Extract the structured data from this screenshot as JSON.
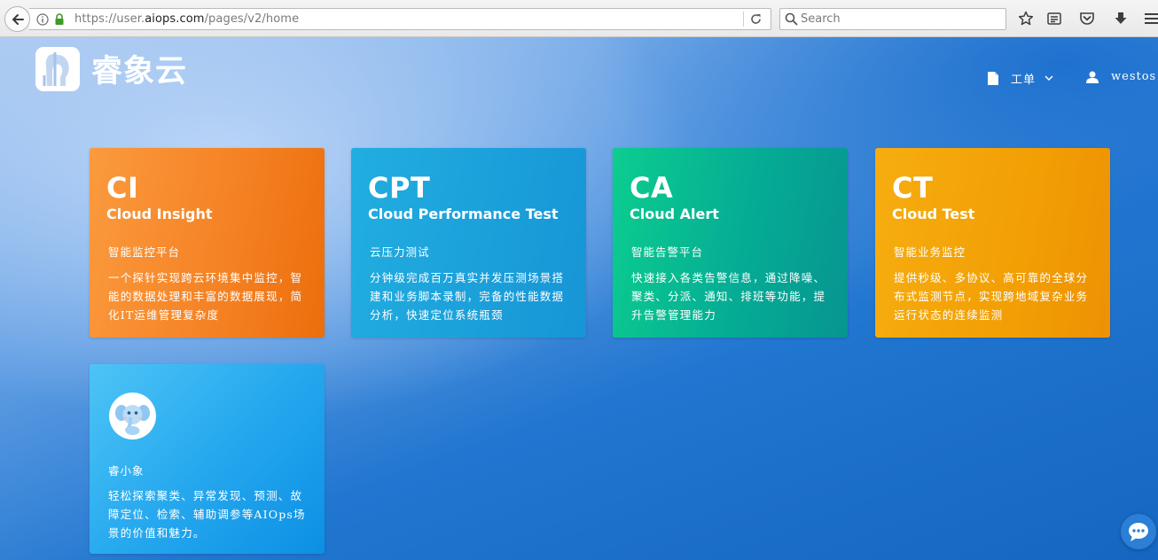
{
  "browser": {
    "url_prefix": "https://user.",
    "url_domain": "aiops.com",
    "url_path": "/pages/v2/home",
    "search_placeholder": "Search"
  },
  "header": {
    "logo_text": "睿象云",
    "nav": [
      {
        "label": "工单",
        "icon": "document-icon"
      },
      {
        "label": "westos",
        "icon": "user-icon"
      }
    ]
  },
  "cards": [
    {
      "abbr": "CI",
      "name": "Cloud Insight",
      "subtitle": "智能监控平台",
      "description": "一个探针实现跨云环境集中监控，智能的数据处理和丰富的数据展现，简化IT运维管理复杂度",
      "color": "#f58325"
    },
    {
      "abbr": "CPT",
      "name": "Cloud Performance Test",
      "subtitle": "云压力测试",
      "description": "分钟级完成百万真实并发压测场景搭建和业务脚本录制，完备的性能数据分析，快速定位系统瓶颈",
      "color": "#1a9fdb"
    },
    {
      "abbr": "CA",
      "name": "Cloud Alert",
      "subtitle": "智能告警平台",
      "description": "快速接入各类告警信息，通过降噪、聚类、分派、通知、排班等功能，提升告警管理能力",
      "color": "#05b493"
    },
    {
      "abbr": "CT",
      "name": "Cloud Test",
      "subtitle": "智能业务监控",
      "description": "提供秒级、多协议、高可靠的全球分布式监测节点，实现跨地域复杂业务运行状态的连续监测",
      "color": "#f3a205"
    },
    {
      "abbr": "",
      "name": "",
      "subtitle": "睿小象",
      "description": "轻松探索聚类、异常发现、预测、故障定位、检索、辅助调参等AIOps场景的价值和魅力。",
      "color": "#27a9ef",
      "icon": "elephant-mascot-icon"
    }
  ],
  "chat": {
    "icon": "chat-bubble-icon"
  }
}
